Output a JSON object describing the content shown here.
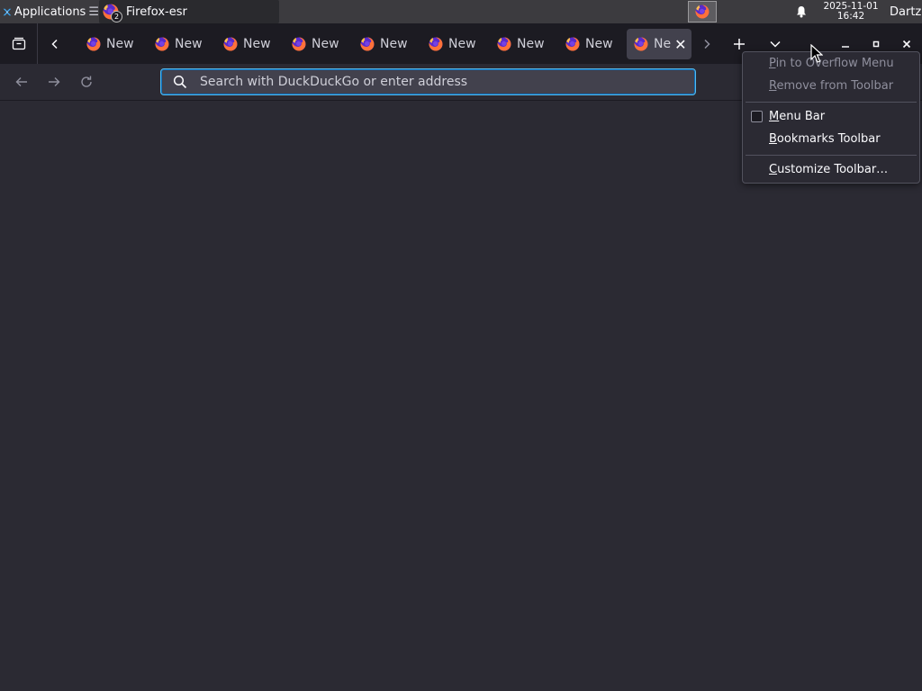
{
  "panel": {
    "apps_label": "Applications",
    "apps_sep": "☰",
    "task_title": "Firefox-esr",
    "task_badge": "2",
    "clock_date": "2025-11-01",
    "clock_time": "16:42",
    "user": "Dartz"
  },
  "tabs": [
    {
      "title": "New"
    },
    {
      "title": "New"
    },
    {
      "title": "New"
    },
    {
      "title": "New"
    },
    {
      "title": "New"
    },
    {
      "title": "New"
    },
    {
      "title": "New"
    },
    {
      "title": "New"
    },
    {
      "title": "Ne",
      "selected": true,
      "close": "✕"
    }
  ],
  "urlbar": {
    "placeholder": "Search with DuckDuckGo or enter address"
  },
  "context_menu": {
    "items": [
      {
        "pre": "",
        "key": "P",
        "post": "in to Overflow Menu",
        "disabled": true
      },
      {
        "pre": "",
        "key": "R",
        "post": "emove from Toolbar",
        "disabled": true
      },
      {
        "pre": "",
        "key": "M",
        "post": "enu Bar",
        "checkbox": true,
        "checked": false
      },
      {
        "pre": "",
        "key": "B",
        "post": "ookmarks Toolbar"
      },
      {
        "pre": "",
        "key": "C",
        "post": "ustomize Toolbar…"
      }
    ]
  },
  "colors": {
    "tabbar": "#1c1b22",
    "toolbar": "#2b2a33",
    "urlbar_focus": "#58b9e8",
    "panel": "#3c3b3f"
  },
  "icons": [
    "applications-logo-icon",
    "firefox-icon",
    "bell-icon",
    "tab-list-icon",
    "chevron-left-icon",
    "chevron-right-icon",
    "plus-icon",
    "chevron-down-icon",
    "minimize-icon",
    "maximize-icon",
    "close-icon",
    "back-arrow-icon",
    "forward-arrow-icon",
    "reload-icon",
    "search-icon"
  ]
}
